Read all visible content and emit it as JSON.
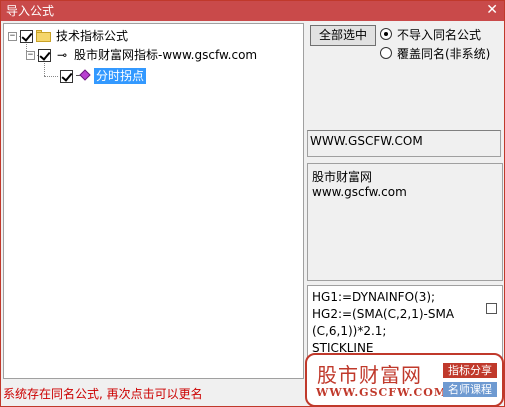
{
  "window": {
    "title": "导入公式",
    "close_glyph": "✕"
  },
  "tree": {
    "root": {
      "label": "技术指标公式",
      "expander": "−",
      "checked": true
    },
    "group": {
      "label": "股市财富网指标-www.gscfw.com",
      "expander": "−",
      "checked": true
    },
    "item": {
      "label": "分时拐点",
      "checked": true,
      "selected": true
    }
  },
  "options": {
    "select_all_label": "全部选中",
    "radio_skip_label": "不导入同名公式",
    "radio_overwrite_label": "覆盖同名(非系统)",
    "selected": "skip"
  },
  "site_field": "WWW.GSCFW.COM",
  "description": [
    "股市财富网",
    "www.gscfw.com"
  ],
  "code": [
    "HG1:=DYNAINFO(3);",
    "HG2:=(SMA(C,2,1)-SMA",
    "(C,6,1))*2.1;",
    "STICKLINE"
  ],
  "status_message": "系统存在同名公式, 再次点击可以更名",
  "watermark": {
    "brand": "股市财富网",
    "url": "WWW.GSCFW.COM",
    "tag1": "指标分享",
    "tag2": "名师课程",
    "accent": "#c0392b",
    "secondary": "#6e9ad1"
  },
  "colors": {
    "titlebar": "#c94a4a",
    "selection": "#3399ff",
    "status": "#cc0000"
  }
}
